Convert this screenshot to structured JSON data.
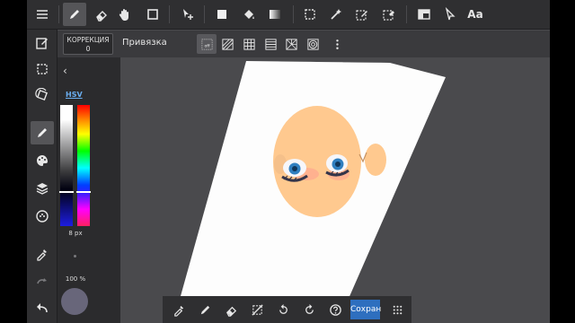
{
  "top_toolbar": {
    "text_tool_label": "Aa",
    "tools": [
      "menu-icon",
      "pen-icon",
      "eraser-icon",
      "hand-icon",
      "rectangle-icon",
      "move-icon",
      "fill-rect-icon",
      "bucket-icon",
      "gradient-icon",
      "select-rect-icon",
      "magic-wand-icon",
      "select-pen-icon",
      "select-eraser-icon",
      "layer-panel-icon",
      "cursor-icon",
      "text-icon"
    ]
  },
  "sub_toolbar": {
    "correction_label": "КОРРЕКЦИЯ",
    "correction_value": "0",
    "snap_label": "Привязка",
    "snap_off_label": "off",
    "snap_options": [
      "snap-off-icon",
      "snap-parallel-icon",
      "snap-grid-icon",
      "snap-lines-icon",
      "snap-radial-icon",
      "snap-circle-icon",
      "more-icon"
    ]
  },
  "left_toolbar": {
    "tools": [
      "edit-page-icon",
      "selection-icon",
      "transform-icon",
      "brush-icon",
      "palette-icon",
      "layers-icon",
      "material-icon",
      "eyedropper-icon",
      "redo-icon",
      "undo-icon"
    ],
    "active": "brush-icon"
  },
  "color_panel": {
    "collapse_glyph": "‹",
    "tab_label": "HSV",
    "brush_size": "8 px",
    "opacity": "100 %",
    "current_color": "#68667a",
    "saturation_marker": 0.71,
    "hue_marker": 0.71
  },
  "bottom_toolbar": {
    "save_label": "Сохран",
    "tools": [
      "eyedropper-icon",
      "pen-icon",
      "eraser-icon",
      "deselect-icon",
      "rotate-left-icon",
      "rotate-right-icon",
      "help-icon",
      "grid-menu-icon"
    ]
  },
  "colors": {
    "accent": "#2e6fbf",
    "toolbar_bg": "#2f2f31",
    "workspace_bg": "#4a4a4d",
    "skin": "#ffc98f",
    "iris": "#2f7fc0"
  }
}
